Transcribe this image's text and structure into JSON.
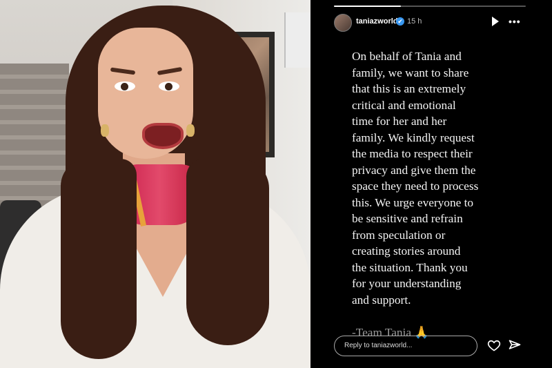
{
  "story": {
    "username": "taniazworld",
    "verified_glyph": "✔",
    "time_ago": "15 h",
    "progress_fraction": 0.35,
    "message": "On behalf of Tania and\nfamily, we want to share\nthat this is an extremely\ncritical and emotional\ntime for her and her\nfamily. We kindly request\nthe media to respect their\nprivacy and give them the\nspace they need to process\nthis. We urge everyone to\nbe sensitive and refrain\nfrom speculation or\ncreating stories around\nthe situation. Thank you\nfor your understanding\nand support.",
    "signature": "-Team Tania 🙏",
    "reply_placeholder": "Reply to taniazworld...",
    "more_glyph": "•••",
    "icons": [
      "play-icon",
      "more-icon",
      "heart-icon",
      "send-icon",
      "verified-badge-icon"
    ]
  },
  "colors": {
    "story_bg": "#000000",
    "text": "#f3f3f3",
    "verified": "#3897f0"
  }
}
